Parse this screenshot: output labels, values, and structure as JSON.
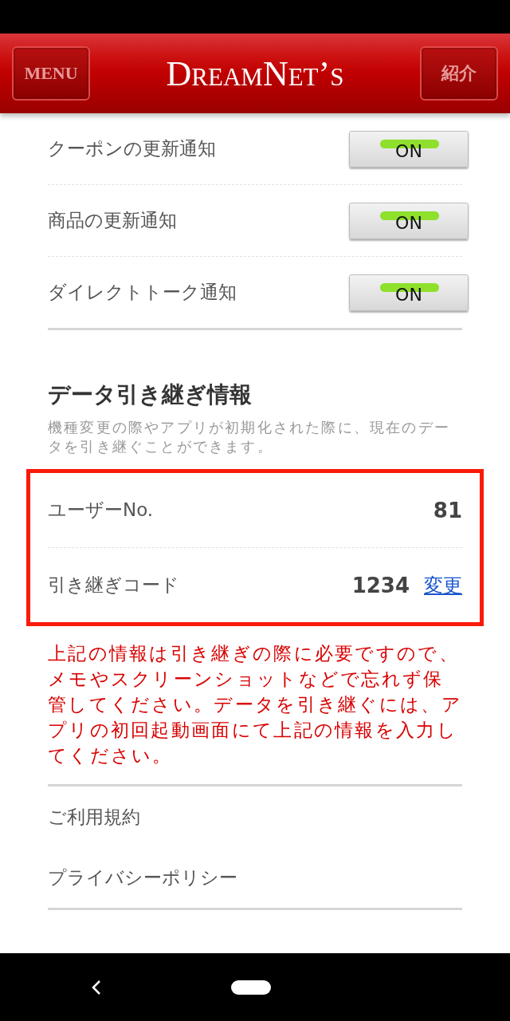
{
  "header": {
    "menu_button": "MENU",
    "logo": "DreamNet’s",
    "intro_button": "紹介"
  },
  "notifications": [
    {
      "label": "クーポンの更新通知",
      "toggle": "ON",
      "on": true
    },
    {
      "label": "商品の更新通知",
      "toggle": "ON",
      "on": true
    },
    {
      "label": "ダイレクトトーク通知",
      "toggle": "ON",
      "on": true
    }
  ],
  "transfer": {
    "title": "データ引き継ぎ情報",
    "description": "機種変更の際やアプリが初期化された際に、現在のデータを引き継ぐことができます。",
    "user_no": {
      "label": "ユーザーNo.",
      "value": "81"
    },
    "code": {
      "label": "引き継ぎコード",
      "value": "1234",
      "link": "変更"
    },
    "notice": "上記の情報は引き継ぎの際に必要ですので、メモやスクリーンショットなどで忘れず保管してください。データを引き継ぐには、アプリの初回起動画面にて上記の情報を入力してください。"
  },
  "links": [
    "ご利用規約",
    "プライバシーポリシー"
  ]
}
